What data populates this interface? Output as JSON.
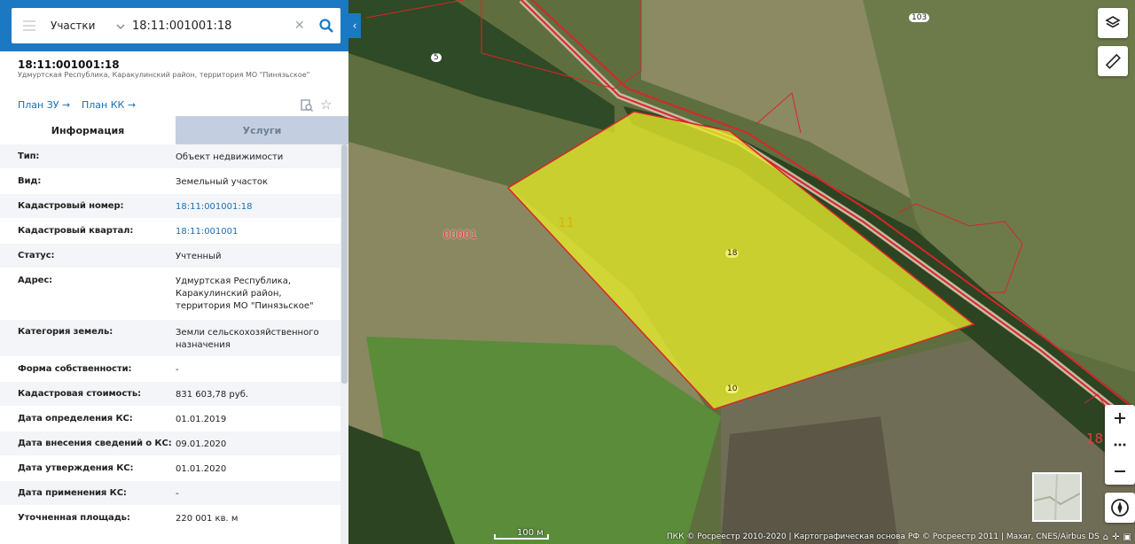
{
  "search": {
    "category": "Участки",
    "query": "18:11:001001:18"
  },
  "object": {
    "title": "18:11:001001:18",
    "subtitle": "Удмуртская Республика, Каракулинский район, территория МО \"Пинязьское\"",
    "plan_zu": "План ЗУ",
    "plan_kk": "План КК"
  },
  "tabs": {
    "info": "Информация",
    "services": "Услуги"
  },
  "rows": [
    {
      "k": "Тип:",
      "v": "Объект недвижимости"
    },
    {
      "k": "Вид:",
      "v": "Земельный участок"
    },
    {
      "k": "Кадастровый номер:",
      "v": "18:11:001001:18"
    },
    {
      "k": "Кадастровый квартал:",
      "v": "18:11:001001"
    },
    {
      "k": "Статус:",
      "v": "Учтенный"
    },
    {
      "k": "Адрес:",
      "v": "Удмуртская Республика, Каракулинский район, территория МО \"Пинязьское\""
    },
    {
      "k": "Категория земель:",
      "v": "Земли сельскохозяйственного назначения"
    },
    {
      "k": "Форма собственности:",
      "v": "-"
    },
    {
      "k": "Кадастровая стоимость:",
      "v": "831 603,78 руб."
    },
    {
      "k": "Дата определения КС:",
      "v": "01.01.2019"
    },
    {
      "k": "Дата внесения сведений о КС:",
      "v": "09.01.2020"
    },
    {
      "k": "Дата утверждения КС:",
      "v": "01.01.2020"
    },
    {
      "k": "Дата применения КС:",
      "v": "-"
    },
    {
      "k": "Уточненная площадь:",
      "v": "220 001 кв. м"
    }
  ],
  "map": {
    "label_quarter": "00001",
    "label_parcel_big": "11",
    "label_18": "18",
    "label_10": "10",
    "label_5": "5",
    "label_103": "103",
    "label_18_edge": "18",
    "scale": "100 м",
    "attribution": "ПКК © Росреестр 2010-2020 | Картографическая основа РФ © Росреестр 2011 | Maxar, CNES/Airbus DS"
  },
  "colors": {
    "accent": "#1b78c3",
    "parcel_fill": "#e6ea2a",
    "boundary": "#d8262a"
  },
  "icons": {
    "menu": "hamburger-icon",
    "search": "search-icon",
    "clear": "close-icon",
    "layers": "layers-icon",
    "ruler": "ruler-icon",
    "compass": "compass-icon"
  }
}
